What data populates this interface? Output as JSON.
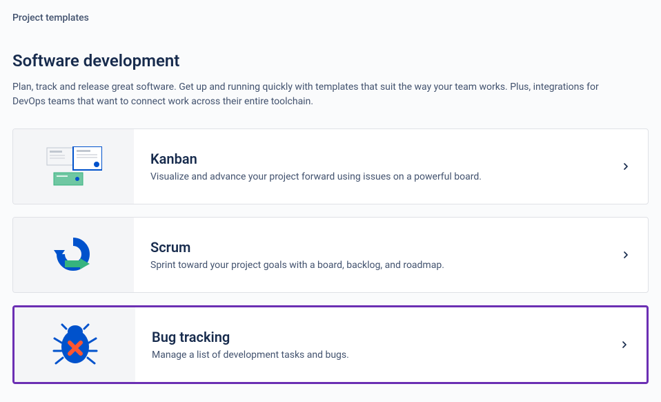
{
  "breadcrumb": "Project templates",
  "header": {
    "title": "Software development",
    "description": "Plan, track and release great software. Get up and running quickly with templates that suit the way your team works. Plus, integrations for DevOps teams that want to connect work across their entire toolchain."
  },
  "templates": [
    {
      "id": "kanban",
      "title": "Kanban",
      "description": "Visualize and advance your project forward using issues on a powerful board.",
      "highlighted": false
    },
    {
      "id": "scrum",
      "title": "Scrum",
      "description": "Sprint toward your project goals with a board, backlog, and roadmap.",
      "highlighted": false
    },
    {
      "id": "bug-tracking",
      "title": "Bug tracking",
      "description": "Manage a list of development tasks and bugs.",
      "highlighted": true
    }
  ]
}
